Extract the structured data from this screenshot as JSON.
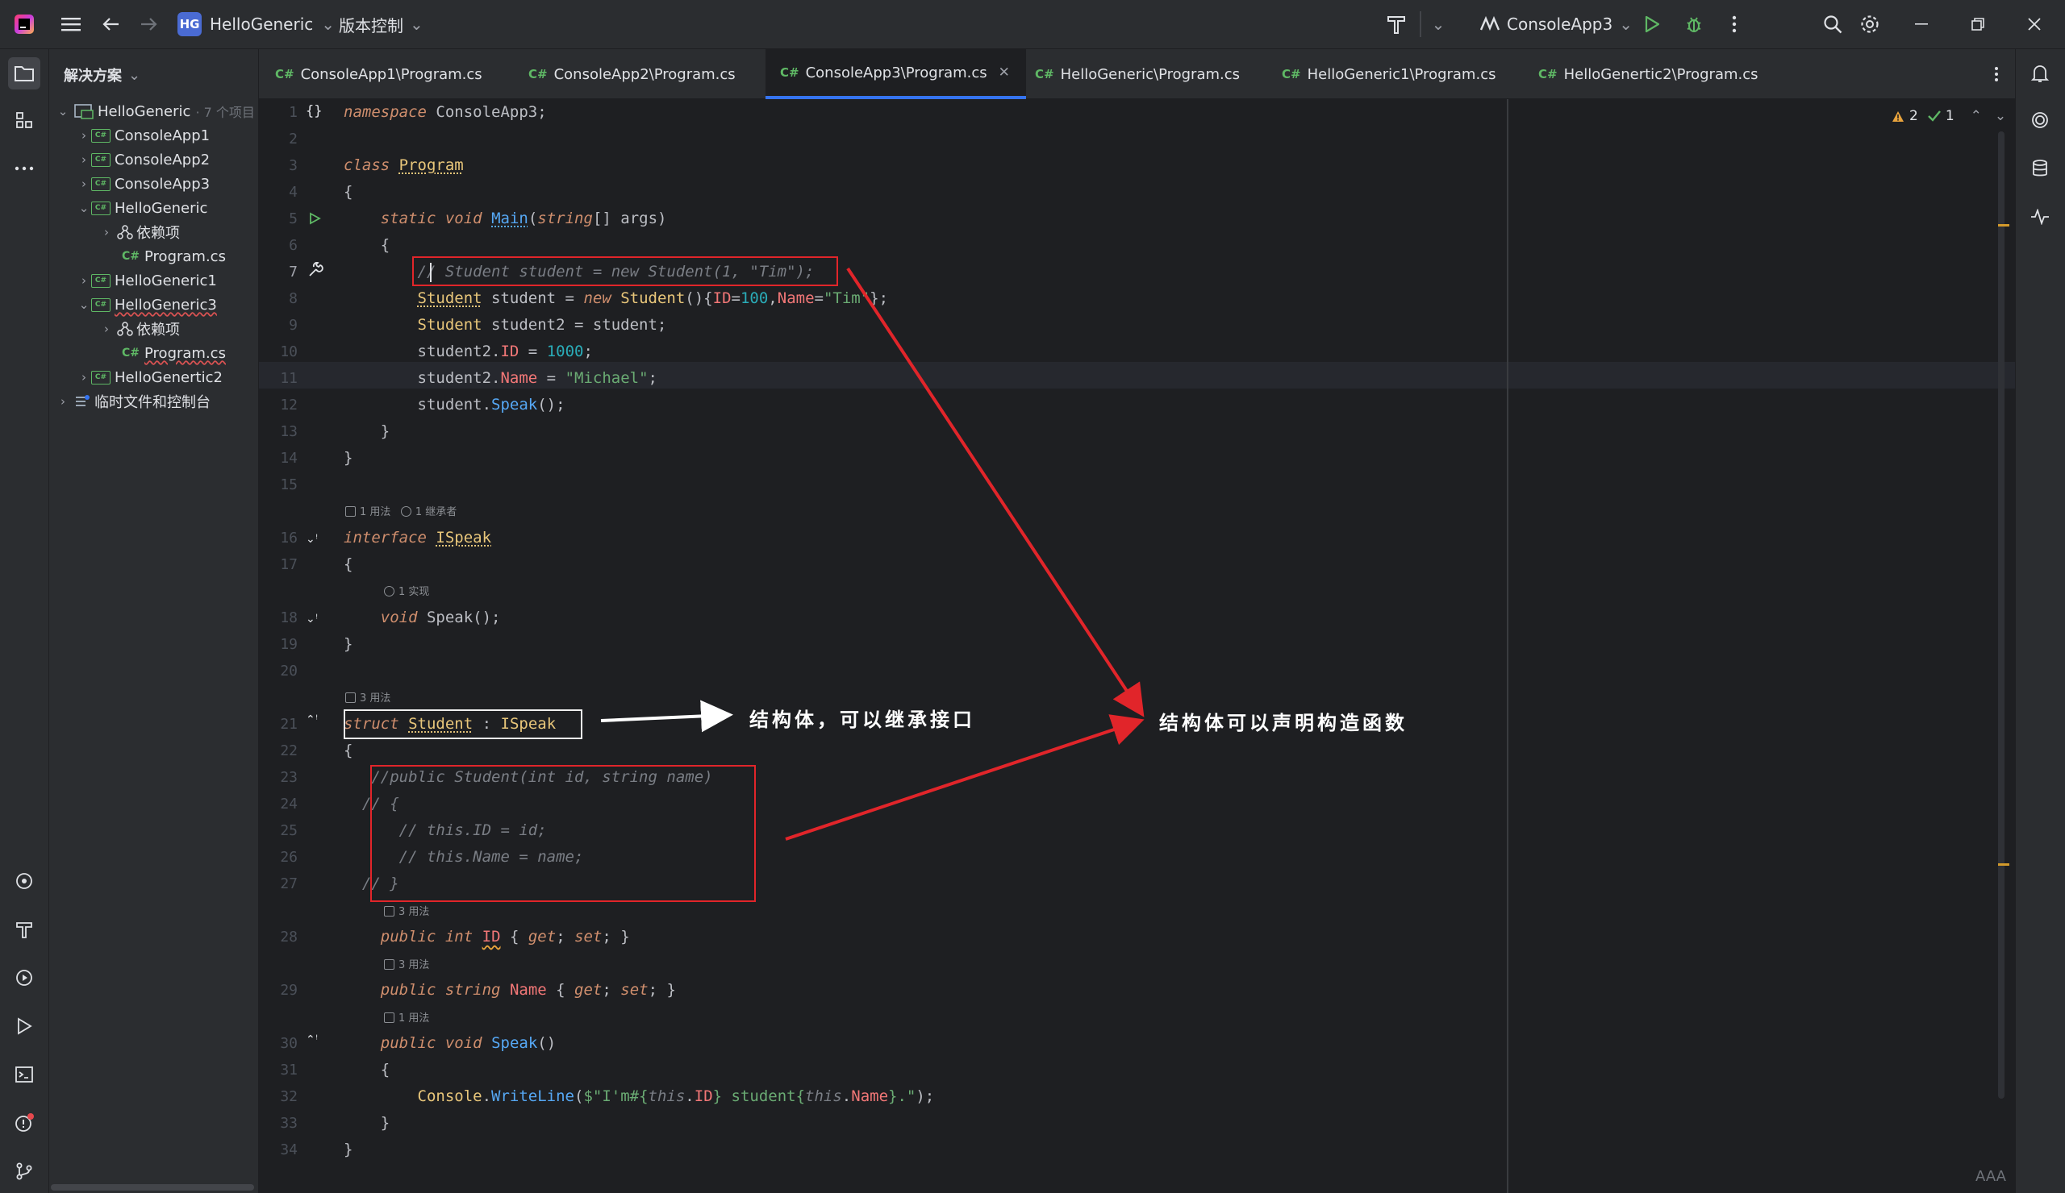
{
  "titlebar": {
    "project_badge": "HG",
    "project_name": "HelloGeneric",
    "vcs_label": "版本控制",
    "run_config": "ConsoleApp3"
  },
  "explorer": {
    "title": "解决方案",
    "root": {
      "label": "HelloGeneric",
      "meta": "· 7 个项目"
    },
    "items": [
      {
        "label": "ConsoleApp1"
      },
      {
        "label": "ConsoleApp2"
      },
      {
        "label": "ConsoleApp3"
      },
      {
        "label": "HelloGeneric"
      },
      {
        "label": "依赖项"
      },
      {
        "label": "Program.cs"
      },
      {
        "label": "HelloGeneric1"
      },
      {
        "label": "HelloGeneric3"
      },
      {
        "label": "依赖项"
      },
      {
        "label": "Program.cs"
      },
      {
        "label": "HelloGenertic2"
      },
      {
        "label": "临时文件和控制台"
      }
    ]
  },
  "tabs": [
    {
      "label": "ConsoleApp1\\Program.cs"
    },
    {
      "label": "ConsoleApp2\\Program.cs"
    },
    {
      "label": "ConsoleApp3\\Program.cs"
    },
    {
      "label": "HelloGeneric\\Program.cs"
    },
    {
      "label": "HelloGeneric1\\Program.cs"
    },
    {
      "label": "HelloGenertic2\\Program.cs"
    }
  ],
  "lang_tag": "C#",
  "inspection": {
    "warnings": "2",
    "ok": "1"
  },
  "hints": {
    "h1": "1 用法",
    "h2": "1 继承者",
    "h3": "1 实现",
    "h4": "3 用法",
    "h5": "3 用法",
    "h6": "3 用法",
    "h7": "1 用法"
  },
  "line_numbers": [
    "1",
    "2",
    "3",
    "4",
    "5",
    "6",
    "7",
    "8",
    "9",
    "10",
    "11",
    "12",
    "13",
    "14",
    "15",
    "16",
    "17",
    "18",
    "19",
    "20",
    "21",
    "22",
    "23",
    "24",
    "25",
    "26",
    "27",
    "28",
    "29",
    "30",
    "31",
    "32",
    "33",
    "34"
  ],
  "annotations": {
    "note1": "结构体，可以继承接口",
    "note2": "结构体可以声明构造函数"
  },
  "statusbar": {
    "reader_mode": "AAA"
  }
}
